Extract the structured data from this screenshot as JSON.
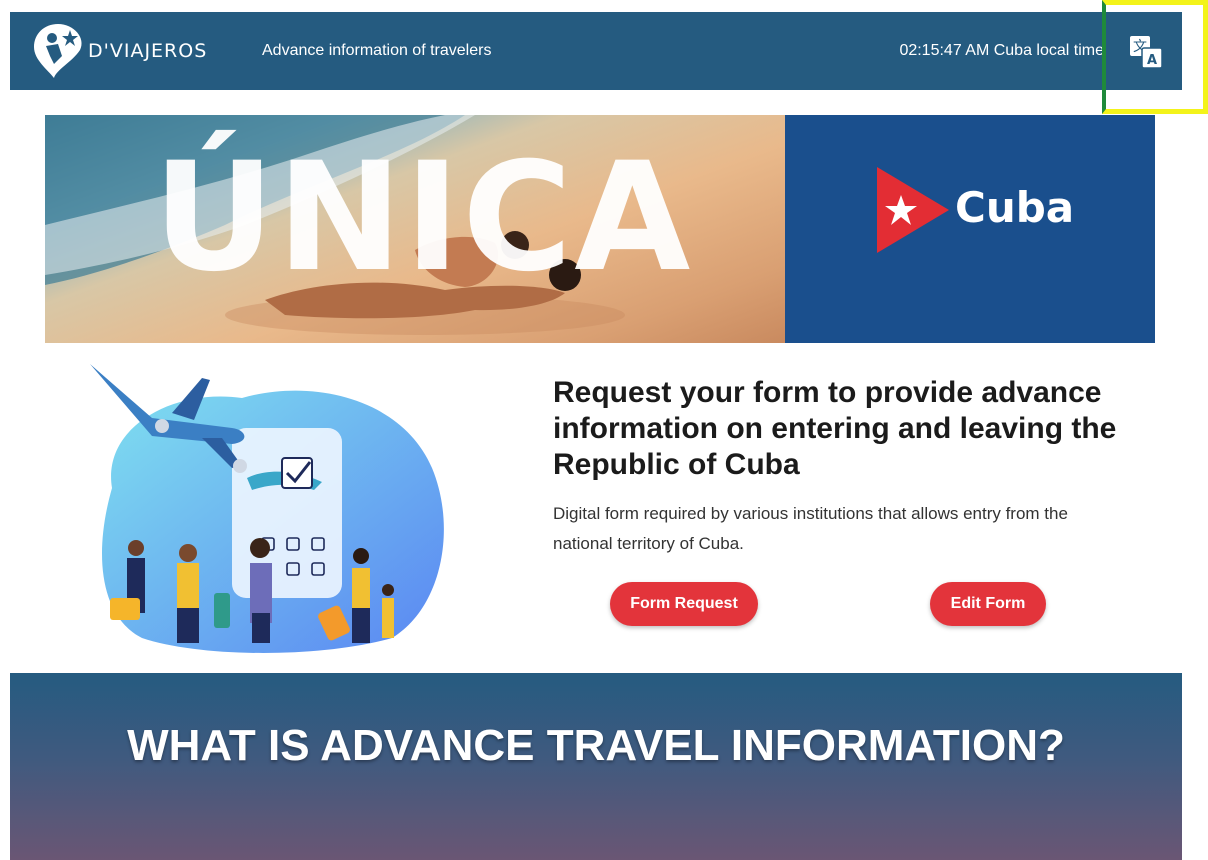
{
  "header": {
    "brand": "D'VIAJEROS",
    "subtitle": "Advance information of travelers",
    "local_time": "02:15:47 AM Cuba local time",
    "translate_icon": "translate-icon"
  },
  "banner": {
    "headline": "ÚNICA",
    "country": "Cuba"
  },
  "hero": {
    "title": "Request your form to provide advance information on entering and leaving the Republic of Cuba",
    "description": "Digital form required by various institutions that allows entry from the national territory of Cuba.",
    "request_button": "Form Request",
    "edit_button": "Edit Form"
  },
  "info": {
    "title": "WHAT IS ADVANCE TRAVEL INFORMATION?"
  },
  "colors": {
    "header_bg": "#255b80",
    "accent_button": "#e3343b",
    "cuba_blue": "#1a4f8d",
    "highlight": "#f3f31a"
  }
}
